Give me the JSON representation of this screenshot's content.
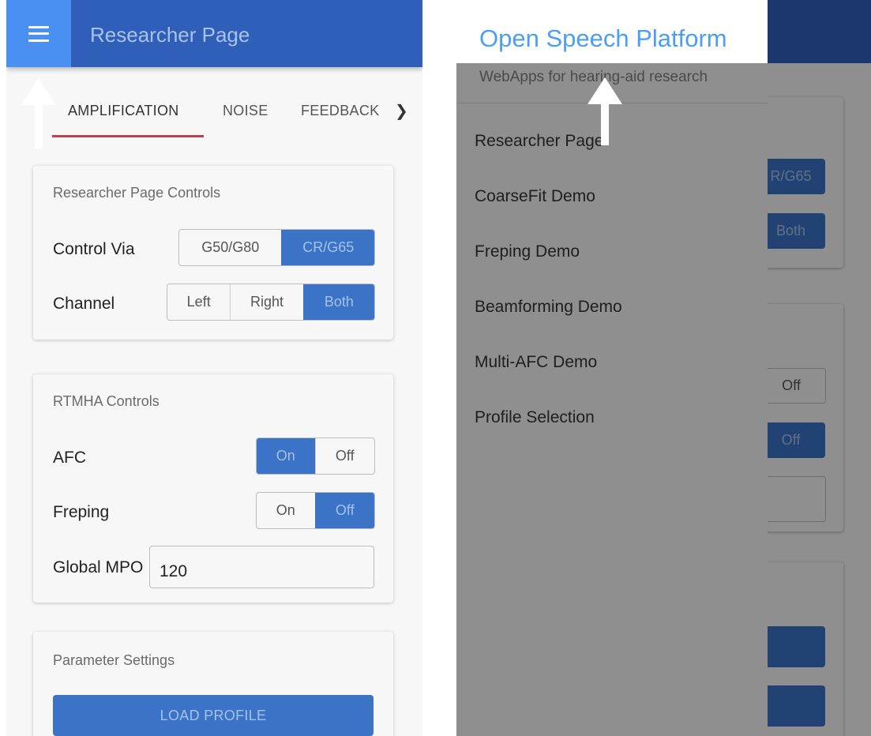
{
  "left": {
    "appbar": {
      "title": "Researcher Page",
      "menu_icon": "hamburger-icon"
    },
    "tabs": [
      {
        "label": "AMPLIFICATION",
        "active": true
      },
      {
        "label": "NOISE"
      },
      {
        "label": "FEEDBACK"
      }
    ],
    "tab_scroll_icon": "chevron-right-icon",
    "controls_card": {
      "title": "Researcher Page Controls",
      "control_via": {
        "label": "Control Via",
        "options": [
          "G50/G80",
          "CR/G65"
        ],
        "selected": "CR/G65"
      },
      "channel": {
        "label": "Channel",
        "options": [
          "Left",
          "Right",
          "Both"
        ],
        "selected": "Both"
      }
    },
    "rtmha_card": {
      "title": "RTMHA Controls",
      "afc": {
        "label": "AFC",
        "options": [
          "On",
          "Off"
        ],
        "selected": "On"
      },
      "freping": {
        "label": "Freping",
        "options": [
          "On",
          "Off"
        ],
        "selected": "Off"
      },
      "global_mpo": {
        "label": "Global MPO",
        "value": "120"
      }
    },
    "params_card": {
      "title": "Parameter Settings",
      "button": "LOAD PROFILE"
    }
  },
  "right": {
    "drawer": {
      "title": "Open Speech Platform",
      "subtitle": "WebApps for hearing-aid research",
      "items": [
        "Researcher Page",
        "CoarseFit Demo",
        "Freping Demo",
        "Beamforming Demo",
        "Multi-AFC Demo",
        "Profile Selection"
      ]
    },
    "background": {
      "seg_fragment": "R/G65",
      "both_label": "Both",
      "off_label_1": "Off",
      "off_label_2": "Off"
    }
  },
  "colors": {
    "appbar": "#2f5fb9",
    "menu_button": "#4a90f2",
    "active_segment": "#3b73c7",
    "tab_underline": "#c0404d",
    "drawer_title": "#4a9ef5"
  }
}
